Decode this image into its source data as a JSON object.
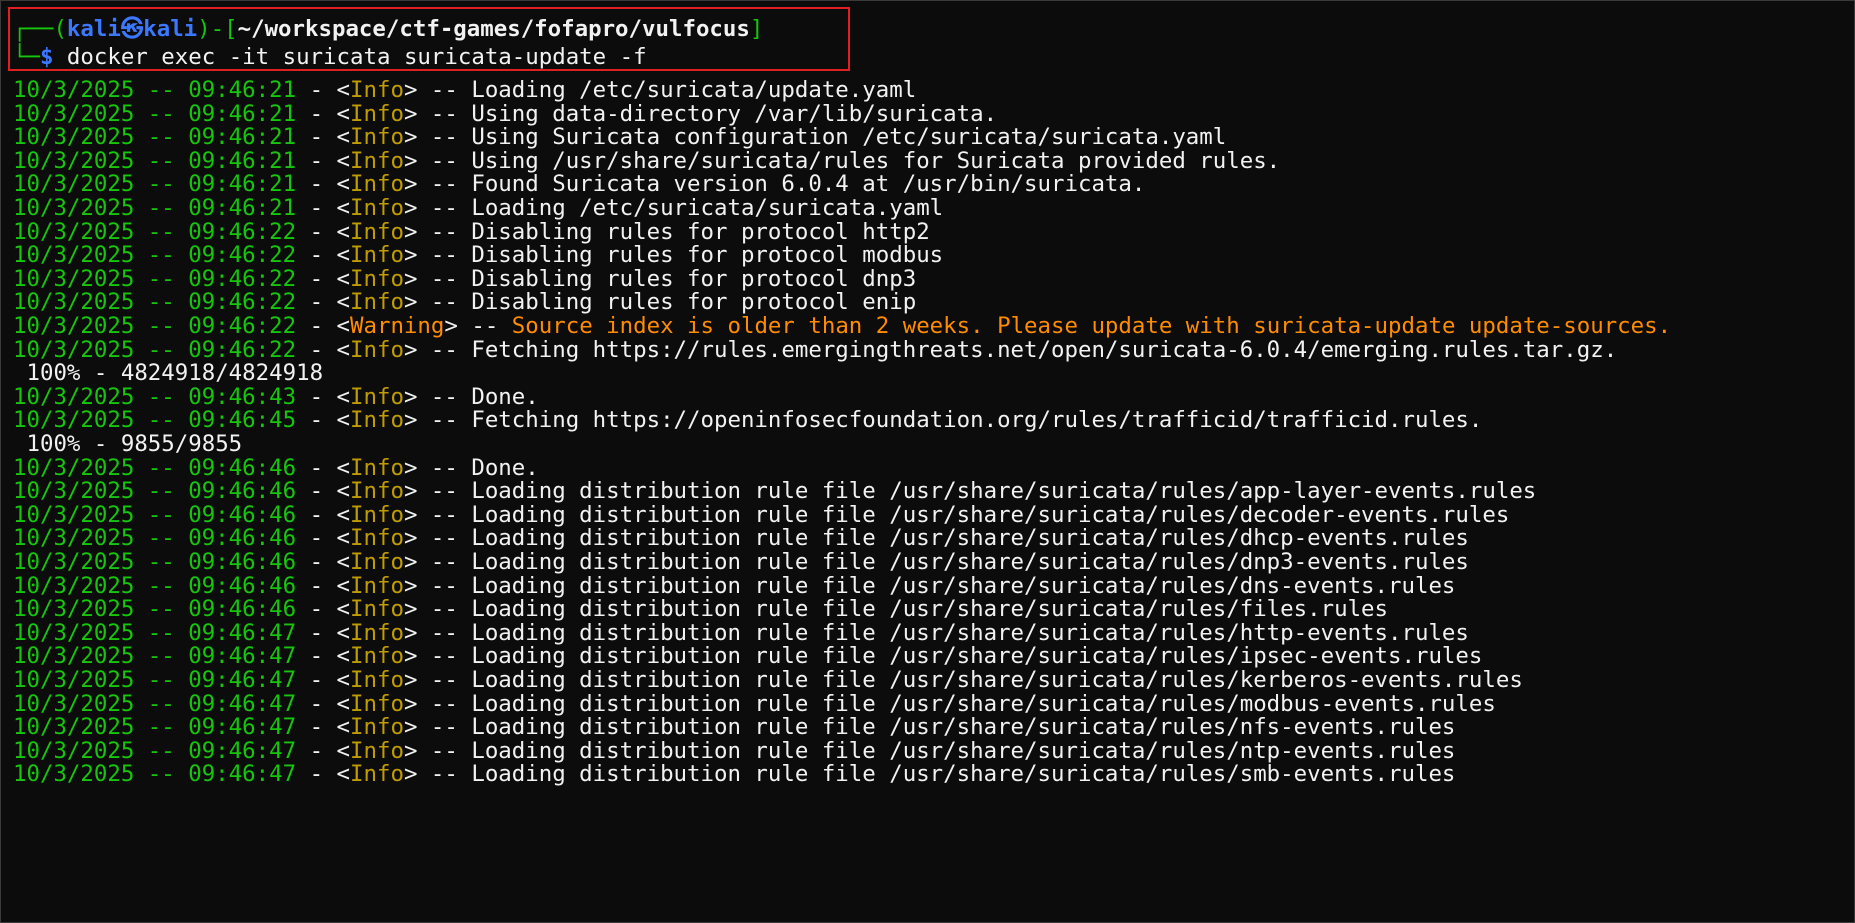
{
  "prompt": {
    "corner_top": "┌──(",
    "user": "kali",
    "at_symbol": "㉿",
    "host": "kali",
    "mid": ")-[",
    "path": "~/workspace/ctf-games/fofapro/vulfocus",
    "close": "]",
    "corner_bottom": "└─",
    "dollar": "$",
    "command": " docker exec -it suricata suricata-update -f"
  },
  "colors": {
    "background": "#0c0c0c",
    "green": "#16c60c",
    "blue": "#3b78ff",
    "yellow": "#c19c00",
    "orange": "#ff8c00",
    "white": "#f2f2f2",
    "highlight": "#e02020"
  },
  "log_lines": [
    {
      "type": "log",
      "ts": "10/3/2025 -- 09:46:21",
      "level": "Info",
      "msg": "Loading /etc/suricata/update.yaml"
    },
    {
      "type": "log",
      "ts": "10/3/2025 -- 09:46:21",
      "level": "Info",
      "msg": "Using data-directory /var/lib/suricata."
    },
    {
      "type": "log",
      "ts": "10/3/2025 -- 09:46:21",
      "level": "Info",
      "msg": "Using Suricata configuration /etc/suricata/suricata.yaml"
    },
    {
      "type": "log",
      "ts": "10/3/2025 -- 09:46:21",
      "level": "Info",
      "msg": "Using /usr/share/suricata/rules for Suricata provided rules."
    },
    {
      "type": "log",
      "ts": "10/3/2025 -- 09:46:21",
      "level": "Info",
      "msg": "Found Suricata version 6.0.4 at /usr/bin/suricata."
    },
    {
      "type": "log",
      "ts": "10/3/2025 -- 09:46:21",
      "level": "Info",
      "msg": "Loading /etc/suricata/suricata.yaml"
    },
    {
      "type": "log",
      "ts": "10/3/2025 -- 09:46:22",
      "level": "Info",
      "msg": "Disabling rules for protocol http2"
    },
    {
      "type": "log",
      "ts": "10/3/2025 -- 09:46:22",
      "level": "Info",
      "msg": "Disabling rules for protocol modbus"
    },
    {
      "type": "log",
      "ts": "10/3/2025 -- 09:46:22",
      "level": "Info",
      "msg": "Disabling rules for protocol dnp3"
    },
    {
      "type": "log",
      "ts": "10/3/2025 -- 09:46:22",
      "level": "Info",
      "msg": "Disabling rules for protocol enip"
    },
    {
      "type": "log",
      "ts": "10/3/2025 -- 09:46:22",
      "level": "Warning",
      "msg": "Source index is older than 2 weeks. Please update with suricata-update update-sources."
    },
    {
      "type": "log",
      "ts": "10/3/2025 -- 09:46:22",
      "level": "Info",
      "msg": "Fetching https://rules.emergingthreats.net/open/suricata-6.0.4/emerging.rules.tar.gz."
    },
    {
      "type": "progress",
      "text": " 100% - 4824918/4824918"
    },
    {
      "type": "log",
      "ts": "10/3/2025 -- 09:46:43",
      "level": "Info",
      "msg": "Done."
    },
    {
      "type": "log",
      "ts": "10/3/2025 -- 09:46:45",
      "level": "Info",
      "msg": "Fetching https://openinfosecfoundation.org/rules/trafficid/trafficid.rules."
    },
    {
      "type": "progress",
      "text": " 100% - 9855/9855"
    },
    {
      "type": "log",
      "ts": "10/3/2025 -- 09:46:46",
      "level": "Info",
      "msg": "Done."
    },
    {
      "type": "log",
      "ts": "10/3/2025 -- 09:46:46",
      "level": "Info",
      "msg": "Loading distribution rule file /usr/share/suricata/rules/app-layer-events.rules"
    },
    {
      "type": "log",
      "ts": "10/3/2025 -- 09:46:46",
      "level": "Info",
      "msg": "Loading distribution rule file /usr/share/suricata/rules/decoder-events.rules"
    },
    {
      "type": "log",
      "ts": "10/3/2025 -- 09:46:46",
      "level": "Info",
      "msg": "Loading distribution rule file /usr/share/suricata/rules/dhcp-events.rules"
    },
    {
      "type": "log",
      "ts": "10/3/2025 -- 09:46:46",
      "level": "Info",
      "msg": "Loading distribution rule file /usr/share/suricata/rules/dnp3-events.rules"
    },
    {
      "type": "log",
      "ts": "10/3/2025 -- 09:46:46",
      "level": "Info",
      "msg": "Loading distribution rule file /usr/share/suricata/rules/dns-events.rules"
    },
    {
      "type": "log",
      "ts": "10/3/2025 -- 09:46:46",
      "level": "Info",
      "msg": "Loading distribution rule file /usr/share/suricata/rules/files.rules"
    },
    {
      "type": "log",
      "ts": "10/3/2025 -- 09:46:47",
      "level": "Info",
      "msg": "Loading distribution rule file /usr/share/suricata/rules/http-events.rules"
    },
    {
      "type": "log",
      "ts": "10/3/2025 -- 09:46:47",
      "level": "Info",
      "msg": "Loading distribution rule file /usr/share/suricata/rules/ipsec-events.rules"
    },
    {
      "type": "log",
      "ts": "10/3/2025 -- 09:46:47",
      "level": "Info",
      "msg": "Loading distribution rule file /usr/share/suricata/rules/kerberos-events.rules"
    },
    {
      "type": "log",
      "ts": "10/3/2025 -- 09:46:47",
      "level": "Info",
      "msg": "Loading distribution rule file /usr/share/suricata/rules/modbus-events.rules"
    },
    {
      "type": "log",
      "ts": "10/3/2025 -- 09:46:47",
      "level": "Info",
      "msg": "Loading distribution rule file /usr/share/suricata/rules/nfs-events.rules"
    },
    {
      "type": "log",
      "ts": "10/3/2025 -- 09:46:47",
      "level": "Info",
      "msg": "Loading distribution rule file /usr/share/suricata/rules/ntp-events.rules"
    },
    {
      "type": "log",
      "ts": "10/3/2025 -- 09:46:47",
      "level": "Info",
      "msg": "Loading distribution rule file /usr/share/suricata/rules/smb-events.rules"
    }
  ]
}
